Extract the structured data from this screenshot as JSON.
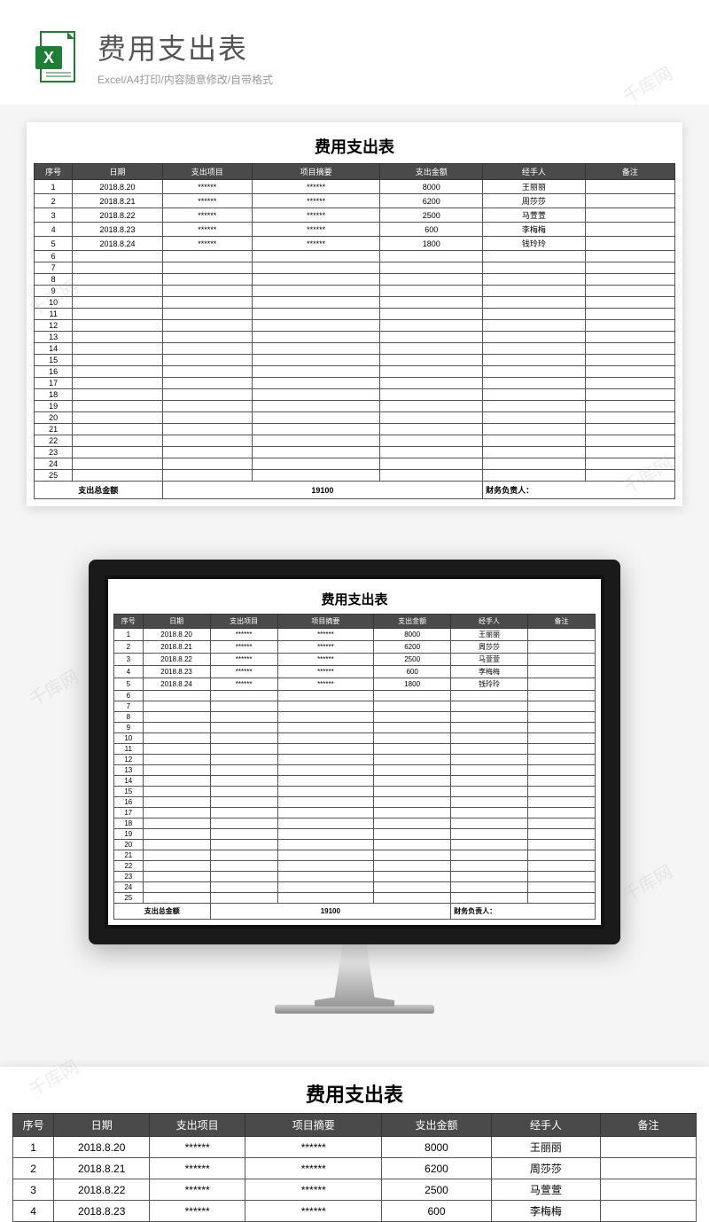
{
  "watermark": "千库网",
  "header": {
    "title": "费用支出表",
    "subtitle": "Excel/A4打印/内容随意修改/自带格式"
  },
  "sheet": {
    "title": "费用支出表",
    "columns": [
      "序号",
      "日期",
      "支出项目",
      "项目摘要",
      "支出金额",
      "经手人",
      "备注"
    ],
    "rows": [
      {
        "seq": "1",
        "date": "2018.8.20",
        "item": "******",
        "summary": "******",
        "amount": "8000",
        "handler": "王丽丽",
        "remark": ""
      },
      {
        "seq": "2",
        "date": "2018.8.21",
        "item": "******",
        "summary": "******",
        "amount": "6200",
        "handler": "周莎莎",
        "remark": ""
      },
      {
        "seq": "3",
        "date": "2018.8.22",
        "item": "******",
        "summary": "******",
        "amount": "2500",
        "handler": "马萱萱",
        "remark": ""
      },
      {
        "seq": "4",
        "date": "2018.8.23",
        "item": "******",
        "summary": "******",
        "amount": "600",
        "handler": "李梅梅",
        "remark": ""
      },
      {
        "seq": "5",
        "date": "2018.8.24",
        "item": "******",
        "summary": "******",
        "amount": "1800",
        "handler": "钱玲玲",
        "remark": ""
      }
    ],
    "emptyRowStart": 6,
    "emptyRowEnd": 25,
    "footer": {
      "totalLabel": "支出总金额",
      "totalValue": "19100",
      "signerLabel": "财务负责人："
    }
  },
  "bottomCrop": {
    "visibleRows": 4
  }
}
